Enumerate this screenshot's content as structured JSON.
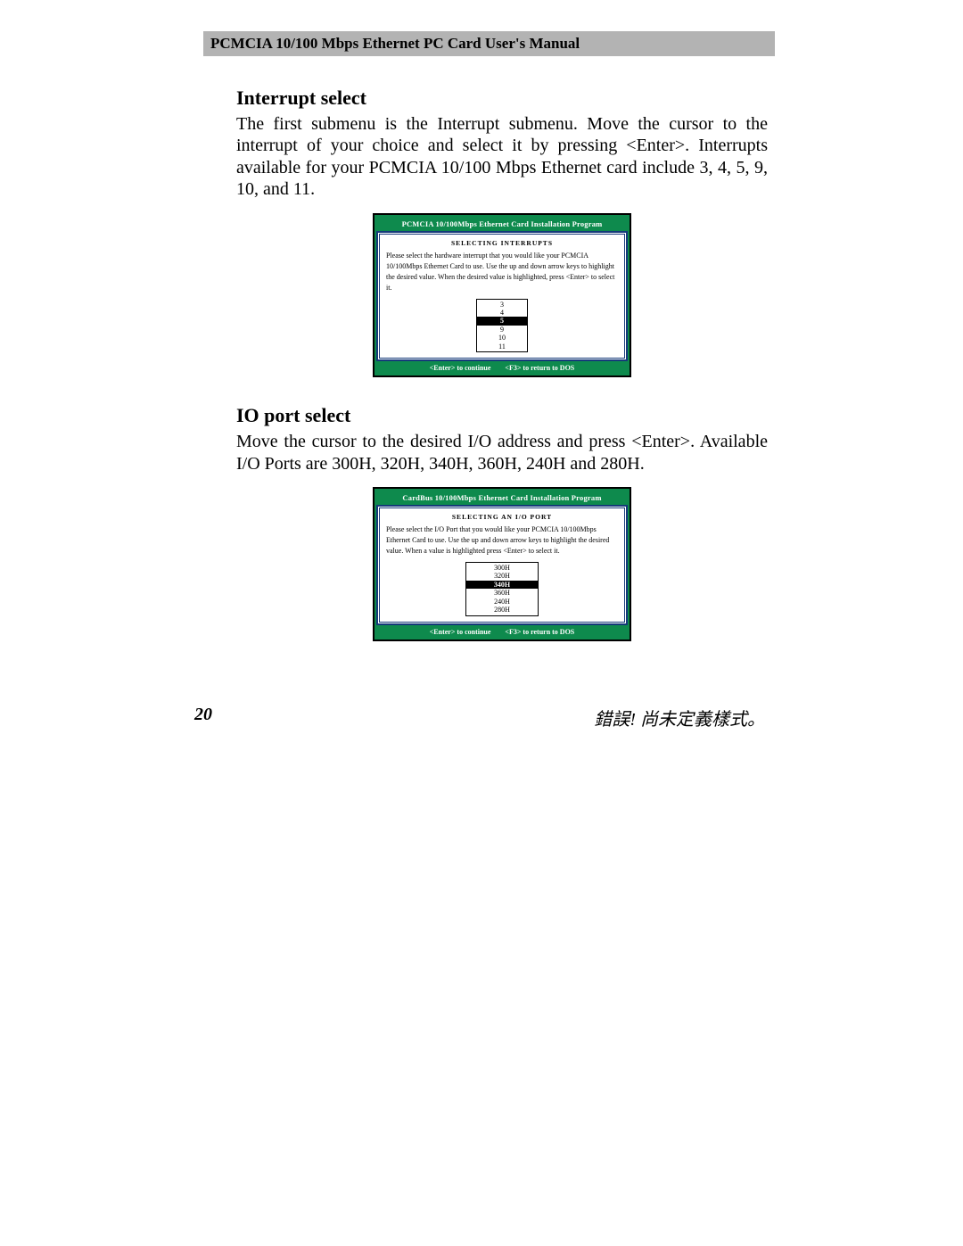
{
  "header": {
    "title": "PCMCIA 10/100 Mbps Ethernet PC Card User's Manual"
  },
  "section1": {
    "heading": "Interrupt select",
    "body": "The first submenu is the Interrupt submenu.  Move the cursor to the interrupt of your choice and select it by pressing <Enter>. Interrupts available for your PCMCIA 10/100 Mbps Ethernet card include 3, 4, 5, 9, 10, and 11."
  },
  "window1": {
    "title": "PCMCIA 10/100Mbps Ethernet Card Installation Program",
    "subtitle": "SELECTING  INTERRUPTS",
    "instr": "Please select the hardware interrupt that you would like your PCMCIA 10/100Mbps Ethernet Card to use.  Use the up and down arrow keys to highlight the desired value.  When the desired value is highlighted, press <Enter> to select it.",
    "options": [
      "3",
      "4",
      "5",
      "9",
      "10",
      "11"
    ],
    "selected": "5",
    "foot_enter": "<Enter> to continue",
    "foot_f3": "<F3> to return to DOS"
  },
  "section2": {
    "heading": "IO port select",
    "body": "Move the cursor to the desired I/O address and press <Enter>. Available I/O Ports are 300H, 320H, 340H, 360H, 240H and 280H."
  },
  "window2": {
    "title": "CardBus 10/100Mbps Ethernet Card Installation Program",
    "subtitle": "SELECTING AN  I/O PORT",
    "instr": "Please select the I/O Port that you would like your PCMCIA 10/100Mbps Ethernet Card to use.\nUse the up and down arrow keys to highlight the desired value.  When a value is highlighted press <Enter> to select it.",
    "options": [
      "300H",
      "320H",
      "340H",
      "360H",
      "240H",
      "280H"
    ],
    "selected": "340H",
    "foot_enter": "<Enter> to continue",
    "foot_f3": "<F3> to return to DOS"
  },
  "footer": {
    "page_number": "20",
    "error_text": "錯誤! 尚未定義樣式。"
  }
}
